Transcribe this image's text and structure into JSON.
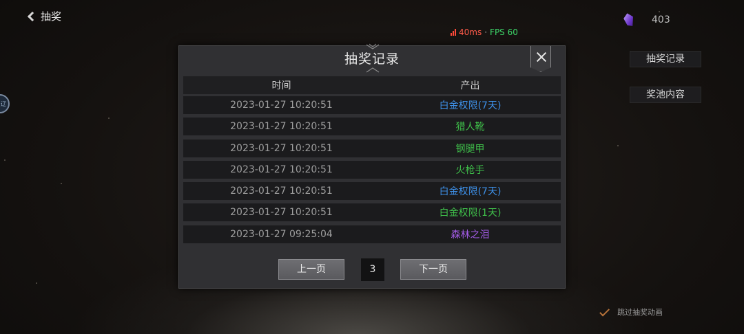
{
  "header": {
    "back_label": "抽奖",
    "back_icon": "chevron-left-icon"
  },
  "side_disc_label": "辽",
  "network": {
    "ping": "40ms",
    "separator": "·",
    "fps": "FPS 60",
    "ping_color": "#ff5a4a",
    "fps_color": "#3ed86a"
  },
  "currency": {
    "icon": "purple-gem-icon",
    "amount": "403"
  },
  "side_buttons": {
    "history": "抽奖记录",
    "pool": "奖池内容"
  },
  "skip_animation": {
    "label": "跳过抽奖动画",
    "checked": true
  },
  "modal": {
    "title": "抽奖记录",
    "close_icon": "close-icon",
    "columns": {
      "time": "时间",
      "output": "产出"
    },
    "rows": [
      {
        "time": "2023-01-27 10:20:51",
        "item": "白金权限(7天)",
        "color": "#3d8fe6"
      },
      {
        "time": "2023-01-27 10:20:51",
        "item": "猎人靴",
        "color": "#3fbf4a"
      },
      {
        "time": "2023-01-27 10:20:51",
        "item": "钢腿甲",
        "color": "#3fbf4a"
      },
      {
        "time": "2023-01-27 10:20:51",
        "item": "火枪手",
        "color": "#3fbf4a"
      },
      {
        "time": "2023-01-27 10:20:51",
        "item": "白金权限(7天)",
        "color": "#3d8fe6"
      },
      {
        "time": "2023-01-27 10:20:51",
        "item": "白金权限(1天)",
        "color": "#3fbf4a"
      },
      {
        "time": "2023-01-27 09:25:04",
        "item": "森林之泪",
        "color": "#a45ce8"
      }
    ],
    "pager": {
      "prev": "上一页",
      "page": "3",
      "next": "下一页"
    }
  }
}
